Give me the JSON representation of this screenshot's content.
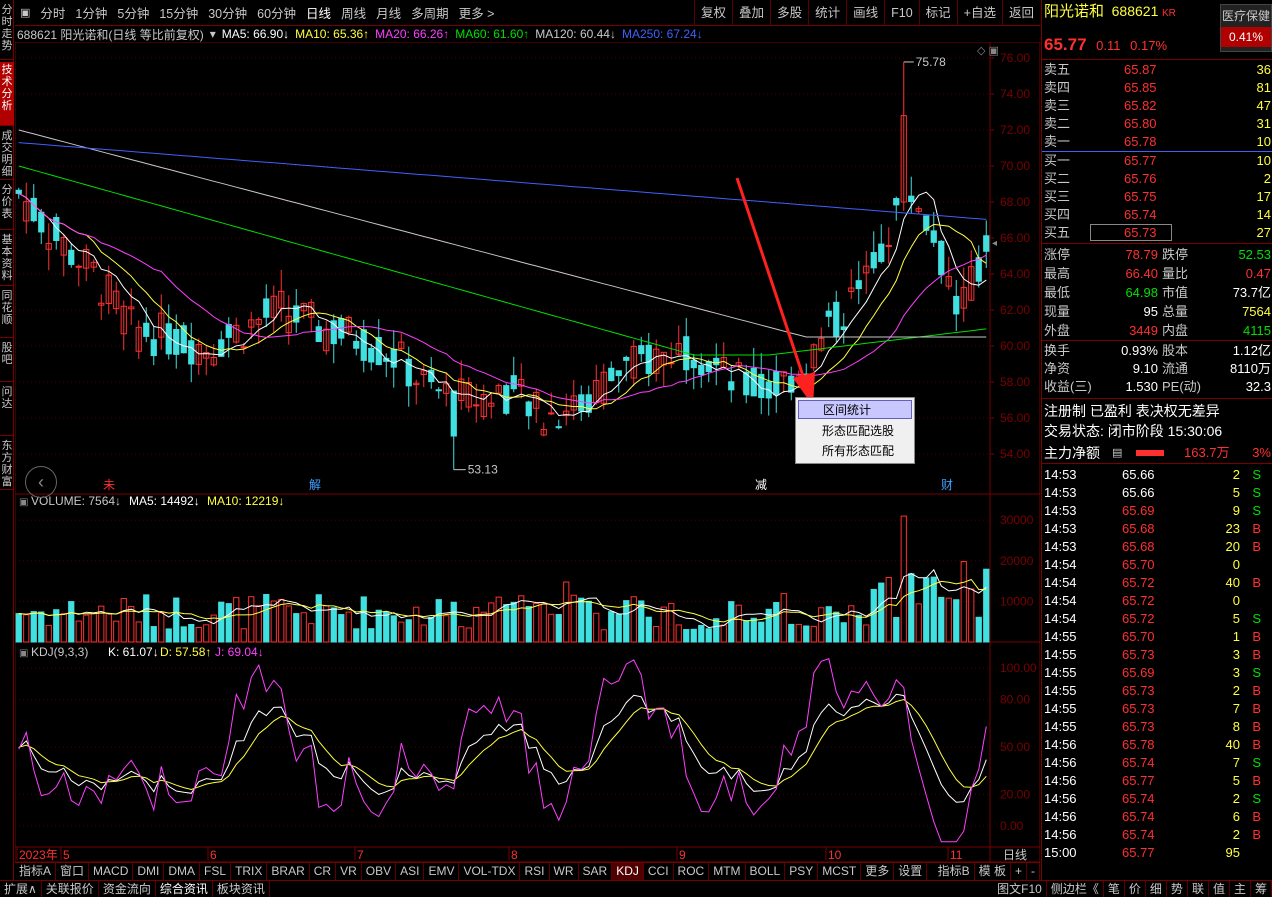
{
  "left_tabs": [
    "分时走势",
    "技术分析",
    "成交明细",
    "分价表",
    "基本资料",
    "同花顺",
    "股吧",
    "问达",
    "东方财富"
  ],
  "toolbar": {
    "periods": [
      "分时",
      "1分钟",
      "5分钟",
      "15分钟",
      "30分钟",
      "60分钟",
      "日线",
      "周线",
      "月线",
      "多周期",
      "更多 >"
    ],
    "active": "日线",
    "right": [
      "复权",
      "叠加",
      "多股",
      "统计",
      "画线",
      "F10",
      "标记",
      "+自选",
      "返回"
    ]
  },
  "legend": {
    "title": "688621 阳光诺和(日线 等比前复权)",
    "ma5": "MA5: 66.90↓",
    "ma10": "MA10: 65.36↑",
    "ma20": "MA20: 66.26↑",
    "ma60": "MA60: 61.60↑",
    "ma120": "MA120: 60.44↓",
    "ma250": "MA250: 67.24↓"
  },
  "vol_legend": {
    "label": "VOLUME: 7564↓",
    "ma5": "MA5: 14492↓",
    "ma10": "MA10: 12219↓"
  },
  "kdj_legend": {
    "label": "KDJ(9,3,3)",
    "k": "K: 61.07↓",
    "d": "D: 57.58↑",
    "j": "J: 69.04↓"
  },
  "price_axis": [
    "76.00",
    "74.00",
    "72.00",
    "70.00",
    "68.00",
    "66.00",
    "64.00",
    "62.00",
    "60.00",
    "58.00",
    "56.00",
    "54.00"
  ],
  "vol_axis": [
    "30000",
    "20000",
    "10000"
  ],
  "kdj_axis": [
    "100.00",
    "80.00",
    "50.00",
    "20.00",
    "0.00"
  ],
  "date_axis": [
    "2023年",
    "5",
    "6",
    "7",
    "8",
    "9",
    "10",
    "11"
  ],
  "date_axis_right": "日线",
  "annotations": {
    "high": "75.78",
    "low": "53.13",
    "markers": [
      "未",
      "解",
      "减",
      "财"
    ]
  },
  "context_menu": [
    "区间统计",
    "形态匹配选股",
    "所有形态匹配"
  ],
  "stock": {
    "name": "阳光诺和",
    "code": "688621",
    "tag": "KR",
    "sector": "医疗保健",
    "sector_pct": "0.41%",
    "price": "65.77",
    "change": "0.11",
    "pct": "0.17%"
  },
  "asks": [
    [
      "卖五",
      "65.87",
      "36"
    ],
    [
      "卖四",
      "65.85",
      "81"
    ],
    [
      "卖三",
      "65.82",
      "47"
    ],
    [
      "卖二",
      "65.80",
      "31"
    ],
    [
      "卖一",
      "65.78",
      "10"
    ]
  ],
  "bids": [
    [
      "买一",
      "65.77",
      "10"
    ],
    [
      "买二",
      "65.76",
      "2"
    ],
    [
      "买三",
      "65.75",
      "17"
    ],
    [
      "买四",
      "65.74",
      "14"
    ],
    [
      "买五",
      "65.73",
      "27"
    ]
  ],
  "stats": [
    [
      "涨停",
      "78.79",
      "跌停",
      "52.53"
    ],
    [
      "最高",
      "66.40",
      "量比",
      "0.47"
    ],
    [
      "最低",
      "64.98",
      "市值",
      "73.7亿"
    ],
    [
      "现量",
      "95",
      "总量",
      "7564"
    ],
    [
      "外盘",
      "3449",
      "内盘",
      "4115"
    ]
  ],
  "stats2": [
    [
      "换手",
      "0.93%",
      "股本",
      "1.12亿"
    ],
    [
      "净资",
      "9.10",
      "流通",
      "8110万"
    ],
    [
      "收益(三)",
      "1.530",
      "PE(动)",
      "32.3"
    ]
  ],
  "info": [
    "注册制 已盈利 表决权无差异",
    "交易状态: 闭市阶段 15:30:06"
  ],
  "flow": {
    "label": "主力净额",
    "value": "163.7万",
    "pct": "3%"
  },
  "ticks": [
    [
      "14:53",
      "65.66",
      "2",
      "S"
    ],
    [
      "14:53",
      "65.66",
      "5",
      "S"
    ],
    [
      "14:53",
      "65.69",
      "9",
      "S"
    ],
    [
      "14:53",
      "65.68",
      "23",
      "B"
    ],
    [
      "14:53",
      "65.68",
      "20",
      "B"
    ],
    [
      "14:54",
      "65.70",
      "0",
      ""
    ],
    [
      "14:54",
      "65.72",
      "40",
      "B"
    ],
    [
      "14:54",
      "65.72",
      "0",
      ""
    ],
    [
      "14:54",
      "65.72",
      "5",
      "S"
    ],
    [
      "14:55",
      "65.70",
      "1",
      "B"
    ],
    [
      "14:55",
      "65.73",
      "3",
      "B"
    ],
    [
      "14:55",
      "65.69",
      "3",
      "S"
    ],
    [
      "14:55",
      "65.73",
      "2",
      "B"
    ],
    [
      "14:55",
      "65.73",
      "7",
      "B"
    ],
    [
      "14:55",
      "65.73",
      "8",
      "B"
    ],
    [
      "14:56",
      "65.78",
      "40",
      "B"
    ],
    [
      "14:56",
      "65.74",
      "7",
      "S"
    ],
    [
      "14:56",
      "65.77",
      "5",
      "B"
    ],
    [
      "14:56",
      "65.74",
      "2",
      "S"
    ],
    [
      "14:56",
      "65.74",
      "6",
      "B"
    ],
    [
      "14:56",
      "65.74",
      "2",
      "B"
    ],
    [
      "15:00",
      "65.77",
      "95",
      ""
    ]
  ],
  "indicators": [
    "指标A",
    "窗口",
    "MACD",
    "DMI",
    "DMA",
    "FSL",
    "TRIX",
    "BRAR",
    "CR",
    "VR",
    "OBV",
    "ASI",
    "EMV",
    "VOL-TDX",
    "RSI",
    "WR",
    "SAR",
    "KDJ",
    "CCI",
    "ROC",
    "MTM",
    "BOLL",
    "PSY",
    "MCST",
    "更多",
    "设置"
  ],
  "ind_right": [
    "指标B",
    "模 板",
    "+",
    "-"
  ],
  "bottom_left": [
    "扩展∧",
    "关联报价",
    "资金流向",
    "综合资讯",
    "板块资讯"
  ],
  "bottom_right": [
    "图文F10",
    "侧边栏《",
    "笔",
    "价",
    "细",
    "势",
    "联",
    "值",
    "主",
    "筹"
  ],
  "colors": {
    "up": "#ff3030",
    "down": "#40e0e0",
    "ma5": "#ffffff",
    "ma10": "#ffff40",
    "ma20": "#ff40ff",
    "ma60": "#00e000",
    "ma120": "#c8c8c8",
    "ma250": "#4060ff",
    "frame": "#7a0000"
  }
}
